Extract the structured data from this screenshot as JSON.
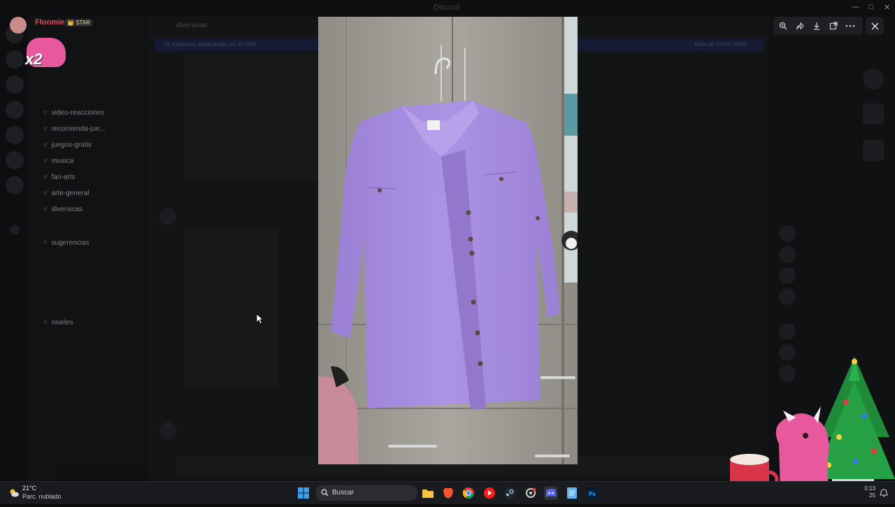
{
  "app": {
    "title": "Discord"
  },
  "streamer": {
    "name": "Floomie",
    "badge": "STAR",
    "multiplier": "x2"
  },
  "channels": {
    "visible": [
      "video-reacciones",
      "recomienda-jue...",
      "juegos-gratis",
      "musica",
      "fan-arts",
      "arte-general",
      "diversicas",
      "sugerencias",
      "niveles"
    ]
  },
  "chat": {
    "channel_header": "diversicas",
    "banner_left": "Te estamos esperando en el chat",
    "banner_right": "Marcar como leído"
  },
  "viewer": {
    "tools": [
      "zoom-icon",
      "forward-icon",
      "download-icon",
      "open-external-icon",
      "more-icon"
    ],
    "close_icon": "close-icon"
  },
  "taskbar": {
    "weather_temp": "21°C",
    "weather_desc": "Parc. nublado",
    "search_label": "Buscar",
    "clock_time": "0:13",
    "clock_date": "25"
  },
  "colors": {
    "shirt": "#a98ee0",
    "accent_red": "#e2465c",
    "mascot_pink": "#e8589c"
  }
}
